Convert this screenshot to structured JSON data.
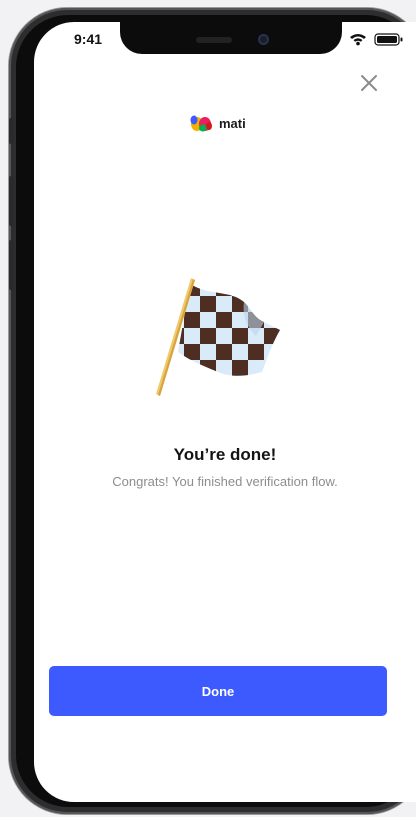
{
  "status_bar": {
    "time": "9:41"
  },
  "header": {
    "logo_text": "mati",
    "close_icon": "close-icon"
  },
  "illustration": {
    "icon": "checkered-flag-icon"
  },
  "content": {
    "title": "You’re done!",
    "subtitle": "Congrats! You finished verification flow."
  },
  "actions": {
    "done_label": "Done"
  },
  "colors": {
    "primary": "#3d5afe",
    "subtitle": "#8d8d8d",
    "frame": "#2d2d2f"
  }
}
